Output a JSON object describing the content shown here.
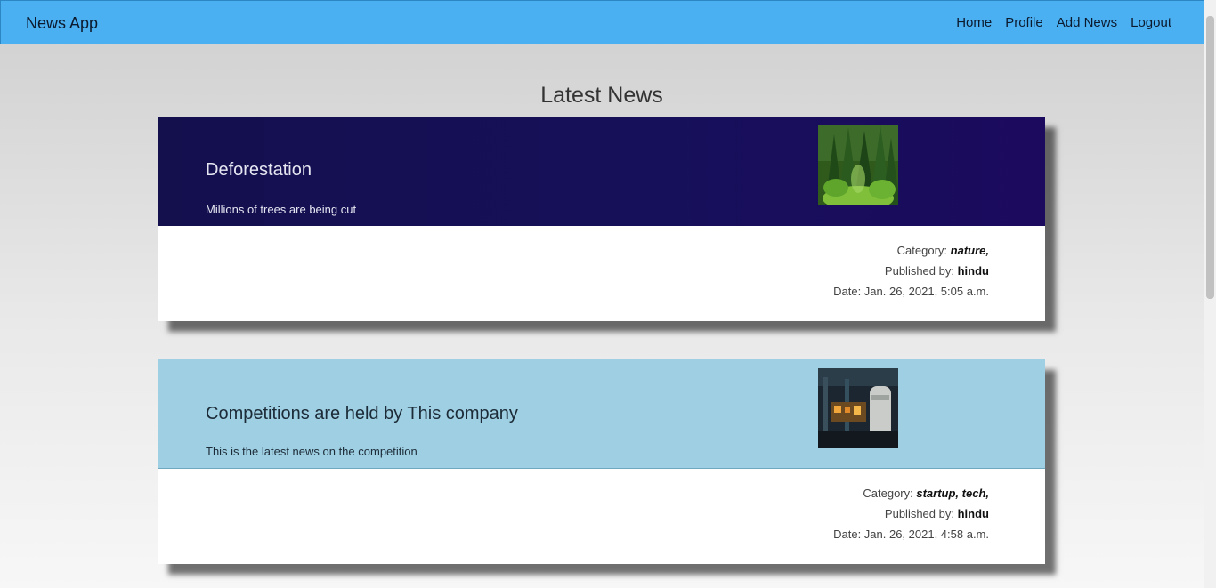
{
  "nav": {
    "brand": "News App",
    "links": [
      "Home",
      "Profile",
      "Add News",
      "Logout"
    ]
  },
  "page": {
    "heading": "Latest News"
  },
  "news": [
    {
      "title": "Deforestation",
      "description": "Millions of trees are being cut",
      "category_label": "Category:",
      "category": "nature,",
      "published_label": "Published by:",
      "publisher": "hindu",
      "date": "Date: Jan. 26, 2021, 5:05 a.m.",
      "image": "forest-image"
    },
    {
      "title": "Competitions are held by This company",
      "description": "This is the latest news on the competition",
      "category_label": "Category:",
      "category": "startup, tech,",
      "published_label": "Published by:",
      "publisher": "hindu",
      "date": "Date: Jan. 26, 2021, 4:58 a.m.",
      "image": "factory-image"
    }
  ],
  "colors": {
    "navbar": "#4ab0f2",
    "card1_header": "#16105a",
    "card2_header": "#9fcfe2"
  }
}
